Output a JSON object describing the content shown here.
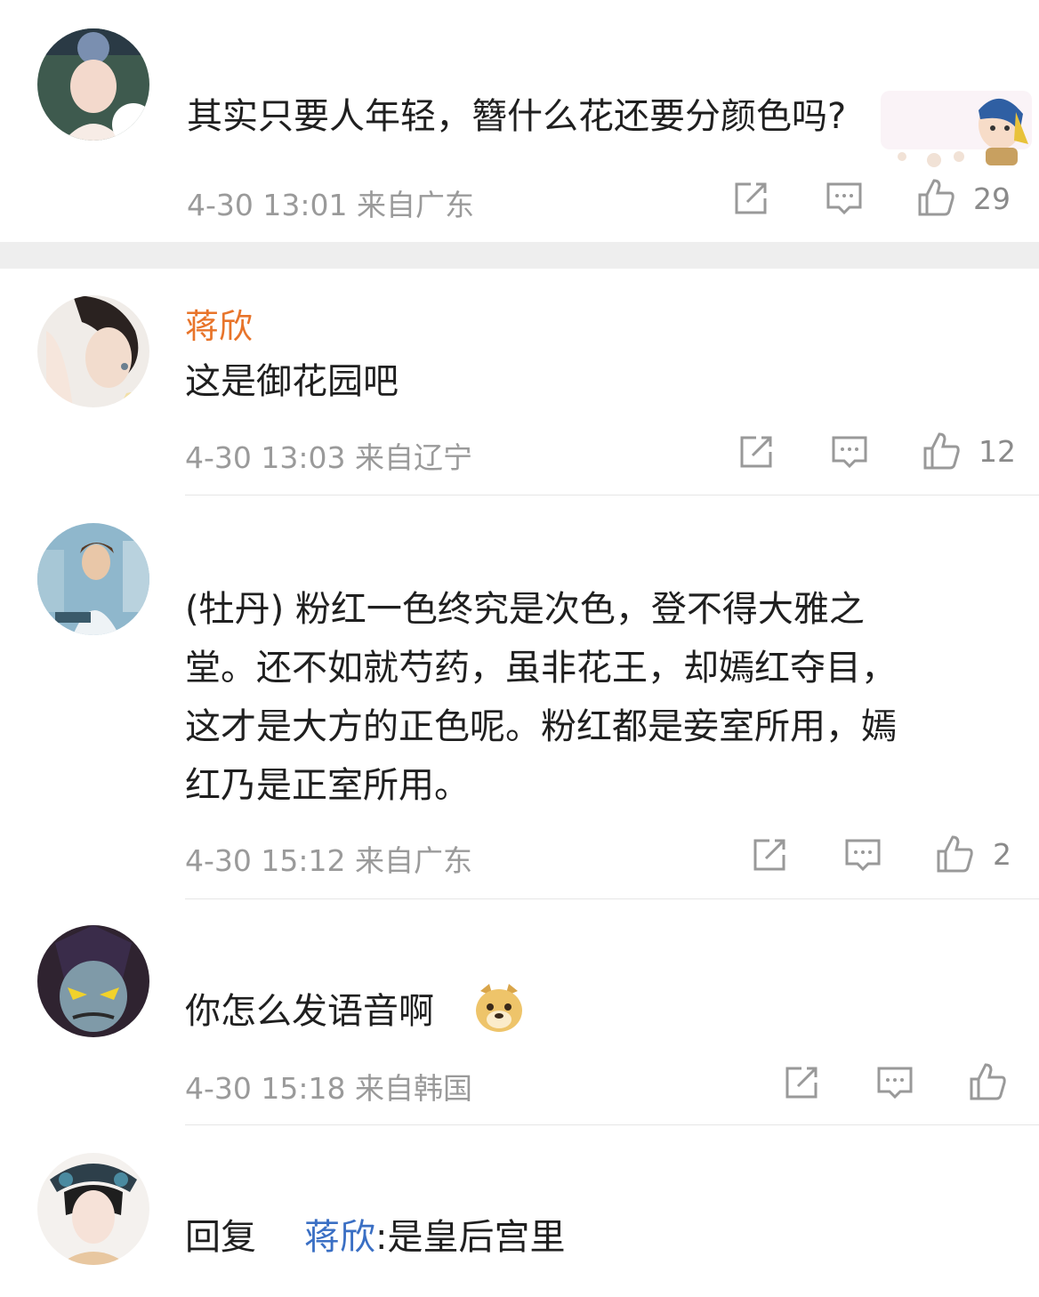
{
  "comments": [
    {
      "text": "其实只要人年轻，簪什么花还要分颜色吗?",
      "time": "4-30 13:01",
      "location": "来自广东",
      "likes": "29",
      "icons": [
        "share-icon",
        "comment-icon",
        "like-icon"
      ]
    },
    {
      "username": "蒋欣",
      "text": "这是御花园吧",
      "time": "4-30 13:03",
      "location": "来自辽宁",
      "likes": "12"
    },
    {
      "text_lines": [
        "(牡丹) 粉红一色终究是次色，登不得大雅之",
        "堂。还不如就芍药，虽非花王，却嫣红夺目，",
        "这才是大方的正色呢。粉红都是妾室所用，嫣",
        "红乃是正室所用。"
      ],
      "time": "4-30 15:12",
      "location": "来自广东",
      "likes": "2"
    },
    {
      "text": "你怎么发语音啊",
      "emoji": "doge-emoji",
      "time": "4-30 15:18",
      "location": "来自韩国",
      "likes": ""
    },
    {
      "reply_prefix": "回复",
      "reply_to": "蒋欣",
      "text": ":是皇后宫里"
    }
  ],
  "colors": {
    "username": "#e8742a",
    "reply_name": "#3a6fc4",
    "meta": "#9a9a9a"
  }
}
